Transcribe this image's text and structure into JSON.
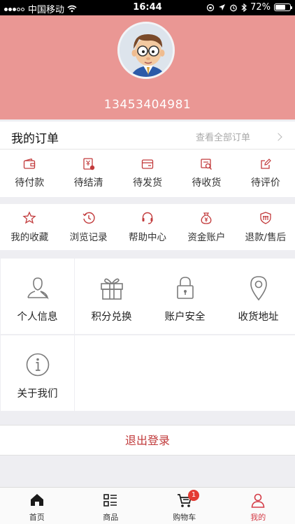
{
  "status_bar": {
    "carrier": "中国移动",
    "time": "16:44",
    "battery_percent": "72%",
    "battery_level": 0.72
  },
  "profile": {
    "phone": "13453404981"
  },
  "orders": {
    "title": "我的订单",
    "view_all": "查看全部订单",
    "items": [
      {
        "label": "待付款",
        "icon": "wallet-icon"
      },
      {
        "label": "待结清",
        "icon": "invoice-icon"
      },
      {
        "label": "待发货",
        "icon": "card-icon"
      },
      {
        "label": "待收货",
        "icon": "parcel-icon"
      },
      {
        "label": "待评价",
        "icon": "edit-icon"
      }
    ]
  },
  "services": {
    "items": [
      {
        "label": "我的收藏",
        "icon": "star-icon"
      },
      {
        "label": "浏览记录",
        "icon": "history-icon"
      },
      {
        "label": "帮助中心",
        "icon": "headset-icon"
      },
      {
        "label": "资金账户",
        "icon": "money-bag-icon"
      },
      {
        "label": "退款/售后",
        "icon": "refund-icon"
      }
    ]
  },
  "grid": {
    "items": [
      {
        "label": "个人信息",
        "icon": "person-icon"
      },
      {
        "label": "积分兑换",
        "icon": "gift-icon"
      },
      {
        "label": "账户安全",
        "icon": "lock-icon"
      },
      {
        "label": "收货地址",
        "icon": "location-pin-icon"
      },
      {
        "label": "关于我们",
        "icon": "info-icon"
      }
    ]
  },
  "logout_label": "退出登录",
  "tabbar": {
    "items": [
      {
        "label": "首页",
        "icon": "home-icon"
      },
      {
        "label": "商品",
        "icon": "list-icon"
      },
      {
        "label": "购物车",
        "icon": "cart-icon",
        "badge": "1"
      },
      {
        "label": "我的",
        "icon": "user-icon",
        "active": true
      }
    ]
  },
  "colors": {
    "header_bg": "#ea9794",
    "accent": "#c0393a",
    "active_tab": "#d43b46",
    "badge": "#e43b33"
  }
}
